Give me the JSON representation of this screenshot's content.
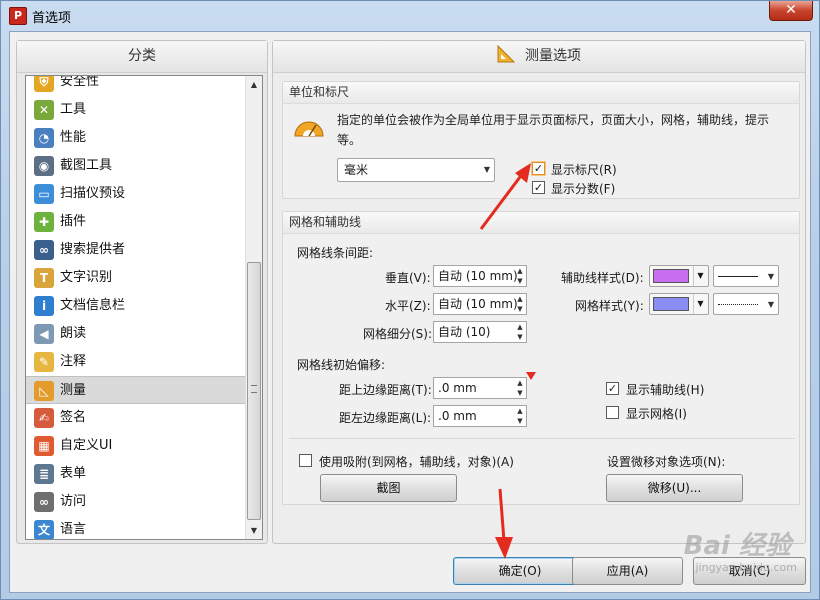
{
  "window": {
    "title": "首选项",
    "close_glyph": "✕"
  },
  "left_panel": {
    "header": "分类",
    "items": [
      {
        "label": "安全性",
        "icon": "shield-icon",
        "color": "#e5a623",
        "glyph": "⛨"
      },
      {
        "label": "工具",
        "icon": "tools-icon",
        "color": "#7aa83b",
        "glyph": "✕"
      },
      {
        "label": "性能",
        "icon": "gauge-icon",
        "color": "#4a7fc0",
        "glyph": "◔"
      },
      {
        "label": "截图工具",
        "icon": "camera-icon",
        "color": "#5d6f84",
        "glyph": "◉"
      },
      {
        "label": "扫描仪预设",
        "icon": "scanner-icon",
        "color": "#3c8ed8",
        "glyph": "▭"
      },
      {
        "label": "插件",
        "icon": "puzzle-icon",
        "color": "#6cb33e",
        "glyph": "✚"
      },
      {
        "label": "搜索提供者",
        "icon": "binoculars-icon",
        "color": "#3b5f8c",
        "glyph": "∞"
      },
      {
        "label": "文字识别",
        "icon": "ocr-icon",
        "color": "#d9a43a",
        "glyph": "T"
      },
      {
        "label": "文档信息栏",
        "icon": "info-icon",
        "color": "#2f7fd0",
        "glyph": "i"
      },
      {
        "label": "朗读",
        "icon": "speaker-icon",
        "color": "#7f98b4",
        "glyph": "◀"
      },
      {
        "label": "注释",
        "icon": "annotation-icon",
        "color": "#e6b640",
        "glyph": "✎"
      },
      {
        "label": "测量",
        "icon": "ruler-icon",
        "color": "#e39b2c",
        "glyph": "◺"
      },
      {
        "label": "签名",
        "icon": "signature-icon",
        "color": "#d65b3c",
        "glyph": "✍"
      },
      {
        "label": "自定义UI",
        "icon": "custom-ui-icon",
        "color": "#e05a32",
        "glyph": "▦"
      },
      {
        "label": "表单",
        "icon": "form-icon",
        "color": "#5e7891",
        "glyph": "≣"
      },
      {
        "label": "访问",
        "icon": "glasses-icon",
        "color": "#6f6f6f",
        "glyph": "∞"
      },
      {
        "label": "语言",
        "icon": "language-icon",
        "color": "#3a86d0",
        "glyph": "文"
      }
    ],
    "selected_item": "测量"
  },
  "right_panel": {
    "header": "测量选项",
    "units_group": {
      "title": "单位和标尺",
      "description": "指定的单位会被作为全局单位用于显示页面标尺，页面大小，网格，辅助线，提示等。",
      "unit_selected": "毫米",
      "show_ruler_label": "显示标尺(R)",
      "show_ruler_checked": true,
      "show_fraction_label": "显示分数(F)",
      "show_fraction_checked": true
    },
    "grid_group": {
      "title": "网格和辅助线",
      "spacing_label": "网格线条间距:",
      "vertical_label": "垂直(V):",
      "vertical_value": "自动 (10 mm)",
      "horizontal_label": "水平(Z):",
      "horizontal_value": "自动 (10 mm)",
      "subdivision_label": "网格细分(S):",
      "subdivision_value": "自动 (10)",
      "guide_style_label": "辅助线样式(D):",
      "guide_color": "#c86ef0",
      "grid_style_label": "网格样式(Y):",
      "grid_color": "#8c8cf5",
      "offset_label": "网格线初始偏移:",
      "top_offset_label": "距上边缘距离(T):",
      "top_offset_value": ".0 mm",
      "left_offset_label": "距左边缘距离(L):",
      "left_offset_value": ".0 mm",
      "show_guides_label": "显示辅助线(H)",
      "show_guides_checked": true,
      "show_grid_label": "显示网格(I)",
      "show_grid_checked": false,
      "snap_label": "使用吸附(到网格，辅助线，对象)(A)",
      "snap_checked": false,
      "snap_button": "截图",
      "nudge_label": "设置微移对象选项(N):",
      "nudge_button": "微移(U)..."
    }
  },
  "footer": {
    "ok_button": "确定(O)",
    "apply_button": "应用(A)",
    "cancel_button": "取消(C)"
  },
  "watermark": {
    "main": "Bai 经验",
    "sub": "jingyan.baidu.com"
  },
  "colors": {
    "arrow_red": "#e42b1f",
    "selection": "#dadada"
  }
}
